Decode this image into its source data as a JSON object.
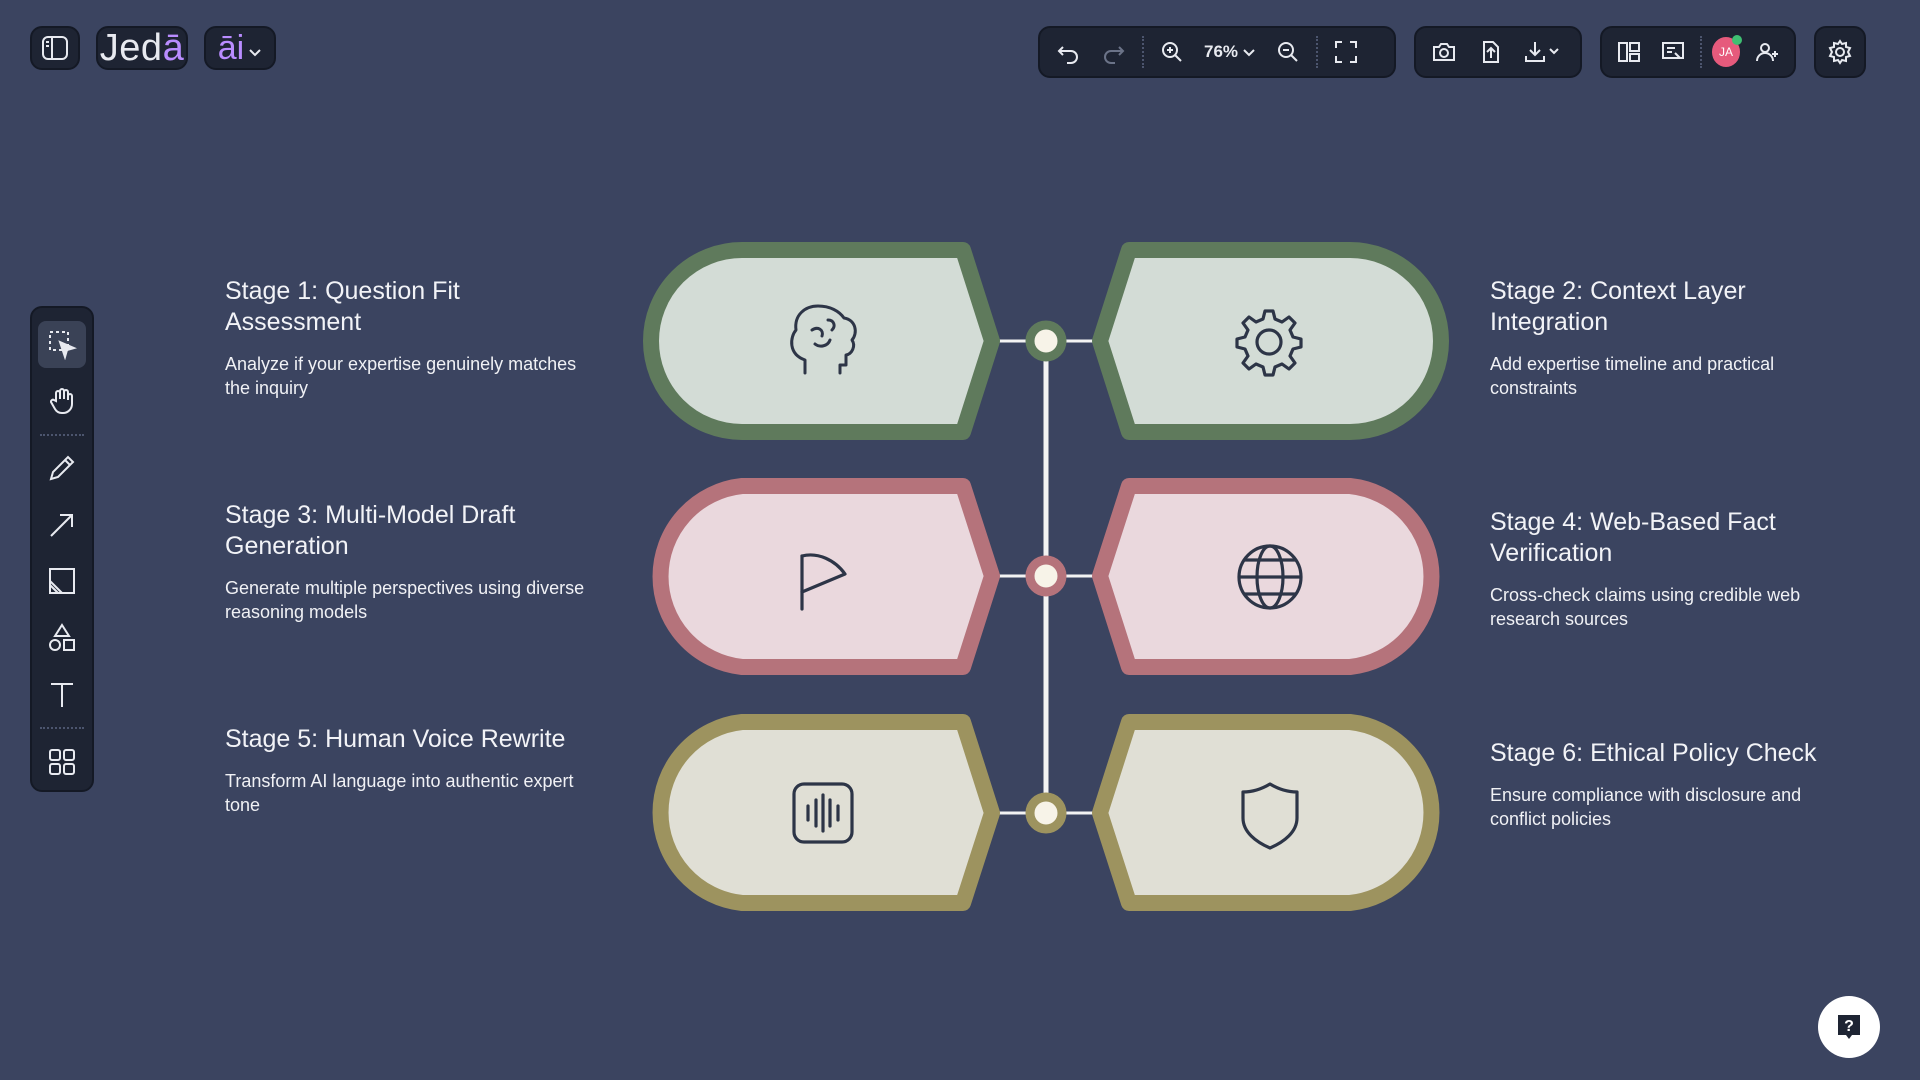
{
  "app": {
    "logo_main": "Jed",
    "logo_accent": "ā",
    "ai_label": "āi"
  },
  "toolbar": {
    "zoom_level": "76%",
    "avatar_initials": "JA"
  },
  "stages": [
    {
      "title": "Stage 1: Question Fit Assessment",
      "description": "Analyze if your expertise genuinely matches the inquiry",
      "icon": "brain-icon"
    },
    {
      "title": "Stage 2: Context Layer Integration",
      "description": "Add expertise timeline and practical constraints",
      "icon": "gear-icon"
    },
    {
      "title": "Stage 3: Multi-Model Draft Generation",
      "description": "Generate multiple perspectives using diverse reasoning models",
      "icon": "flag-icon"
    },
    {
      "title": "Stage 4: Web-Based Fact Verification",
      "description": "Cross-check claims using credible web research sources",
      "icon": "globe-icon"
    },
    {
      "title": "Stage 5: Human Voice Rewrite",
      "description": "Transform AI language into authentic expert tone",
      "icon": "audio-wave-icon"
    },
    {
      "title": "Stage 6: Ethical Policy Check",
      "description": "Ensure compliance with disclosure and conflict policies",
      "icon": "shield-icon"
    }
  ],
  "colors": {
    "background": "#3b4460",
    "green_border": "#5f7a5c",
    "green_fill": "#d3dcd6",
    "pink_border": "#b5737b",
    "pink_fill": "#ead8dd",
    "olive_border": "#9d935f",
    "olive_fill": "#e0dfd5",
    "connector": "#f3f3f3",
    "icon_stroke": "#2d3547"
  }
}
